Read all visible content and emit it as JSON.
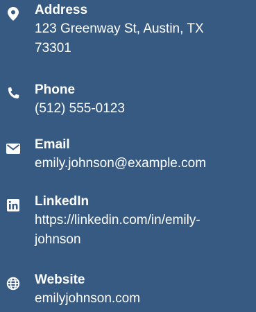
{
  "contact": {
    "items": [
      {
        "icon": "map-pin-icon",
        "label": "Address",
        "value_lines": [
          "123 Greenway St, Austin, TX",
          "73301"
        ]
      },
      {
        "icon": "phone-icon",
        "label": "Phone",
        "value_lines": [
          "(512) 555-0123"
        ]
      },
      {
        "icon": "envelope-icon",
        "label": "Email",
        "value_lines": [
          "emily.johnson@example.com"
        ]
      },
      {
        "icon": "linkedin-icon",
        "label": "LinkedIn",
        "value_lines": [
          "https://linkedin.com/in/emily-",
          "johnson"
        ]
      },
      {
        "icon": "globe-icon",
        "label": "Website",
        "value_lines": [
          "emilyjohnson.com"
        ]
      }
    ]
  },
  "colors": {
    "background": "#365a82",
    "text": "#ffffff"
  }
}
